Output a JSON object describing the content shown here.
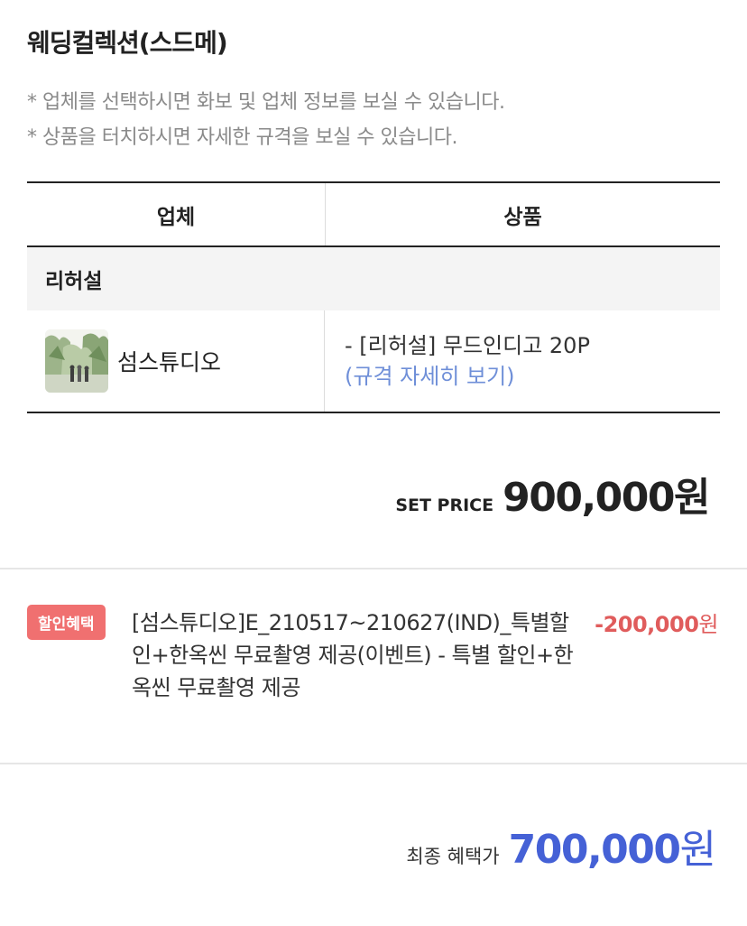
{
  "header": {
    "title": "웨딩컬렉션(스드메)",
    "notices": [
      "* 업체를 선택하시면 화보 및 업체 정보를 보실 수 있습니다.",
      "* 상품을 터치하시면 자세한 규격을 보실 수 있습니다."
    ]
  },
  "table": {
    "columns": [
      "업체",
      "상품"
    ],
    "sections": [
      {
        "name": "리허설",
        "items": [
          {
            "vendor": "섬스튜디오",
            "vendor_thumbnail_icon": "studio-photo",
            "product": "- [리허설] 무드인디고 20P",
            "spec_link": "(규격 자세히 보기)"
          }
        ]
      }
    ]
  },
  "set_price": {
    "label": "SET PRICE",
    "value": "900,000원"
  },
  "discount": {
    "badge": "할인혜택",
    "description": "[섬스튜디오]E_210517~210627(IND)_특별할인+한옥씬 무료촬영 제공(이벤트) - 특별 할인+한옥씬 무료촬영 제공",
    "amount_number": "-200,000",
    "amount_unit": "원"
  },
  "final_price": {
    "label": "최종 혜택가",
    "value": "700,000",
    "unit": "원"
  },
  "colors": {
    "discount_badge": "#f07070",
    "discount_amount": "#e05c5c",
    "final_price": "#4561d6",
    "spec_link": "#6f8fd8"
  }
}
